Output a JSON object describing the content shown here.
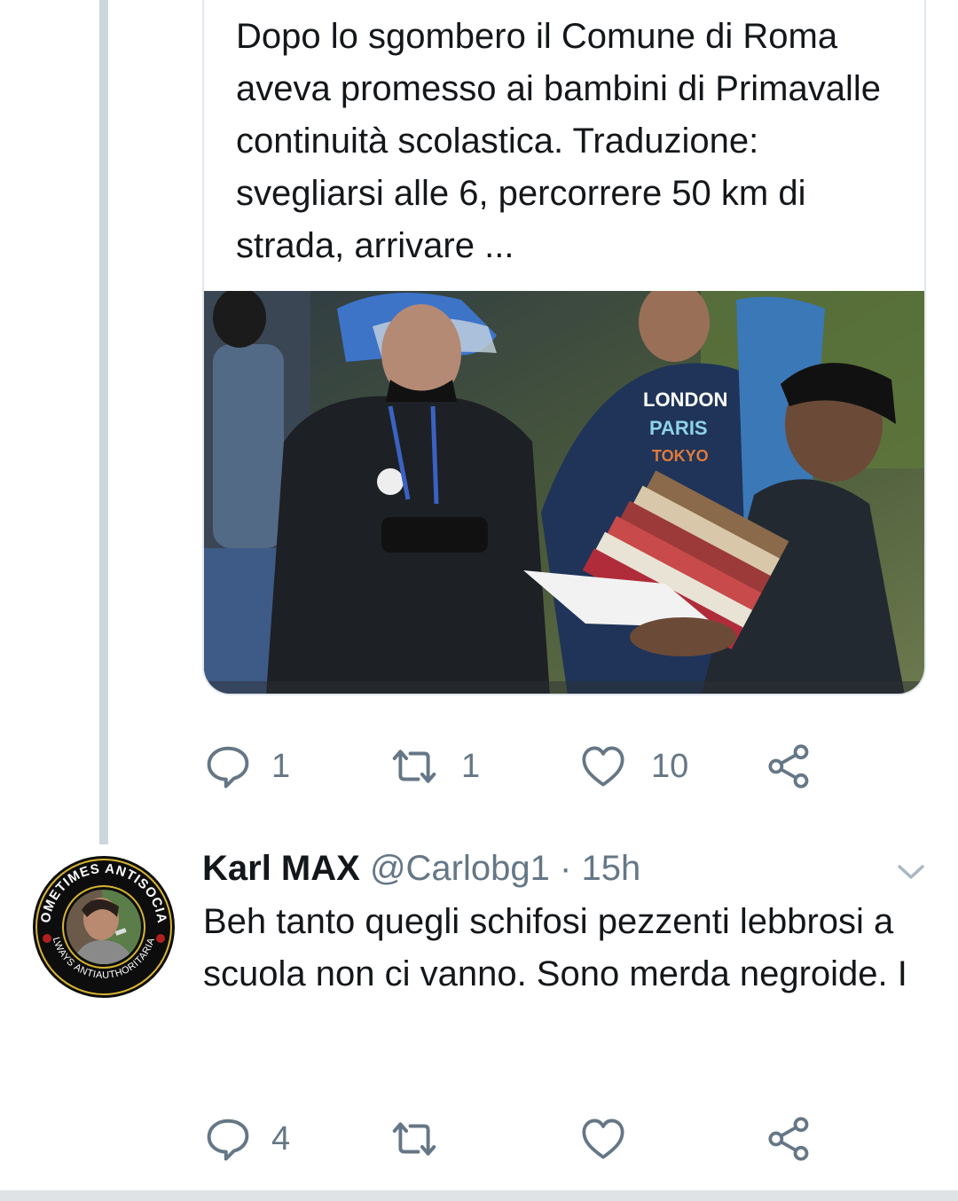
{
  "quoted_card": {
    "text": "Dopo lo sgombero il Comune di Roma aveva promesso ai bambini di Primavalle continuità scolastica. Traduzione: svegliarsi alle 6, percorrere 50 km di strada, arrivare ...",
    "photo_shirt_text": [
      "LONDON",
      "PARIS",
      "TOKYO"
    ]
  },
  "tweet_actions": {
    "reply_count": "1",
    "retweet_count": "1",
    "like_count": "10"
  },
  "reply": {
    "display_name": "Karl MAX",
    "handle": "@Carlobg1",
    "separator": "·",
    "time": "15h",
    "text": "Beh tanto quegli schifosi pezzenti lebbrosi a scuola non ci vanno. Sono merda negroide. I",
    "avatar_ring_text_top": "SOMETIMES ANTISOCIAL",
    "avatar_ring_text_bottom": "ALWAYS ANTIAUTHORITARIAN",
    "actions": {
      "reply_count": "4"
    }
  },
  "icons": {
    "reply": "speech-bubble-icon",
    "retweet": "retweet-arrows-icon",
    "like": "heart-icon",
    "share": "share-nodes-icon",
    "menu": "chevron-down-icon"
  },
  "colors": {
    "text": "#14171a",
    "muted": "#657786",
    "thread": "#ccd6dd",
    "border": "#e1e8ed"
  }
}
